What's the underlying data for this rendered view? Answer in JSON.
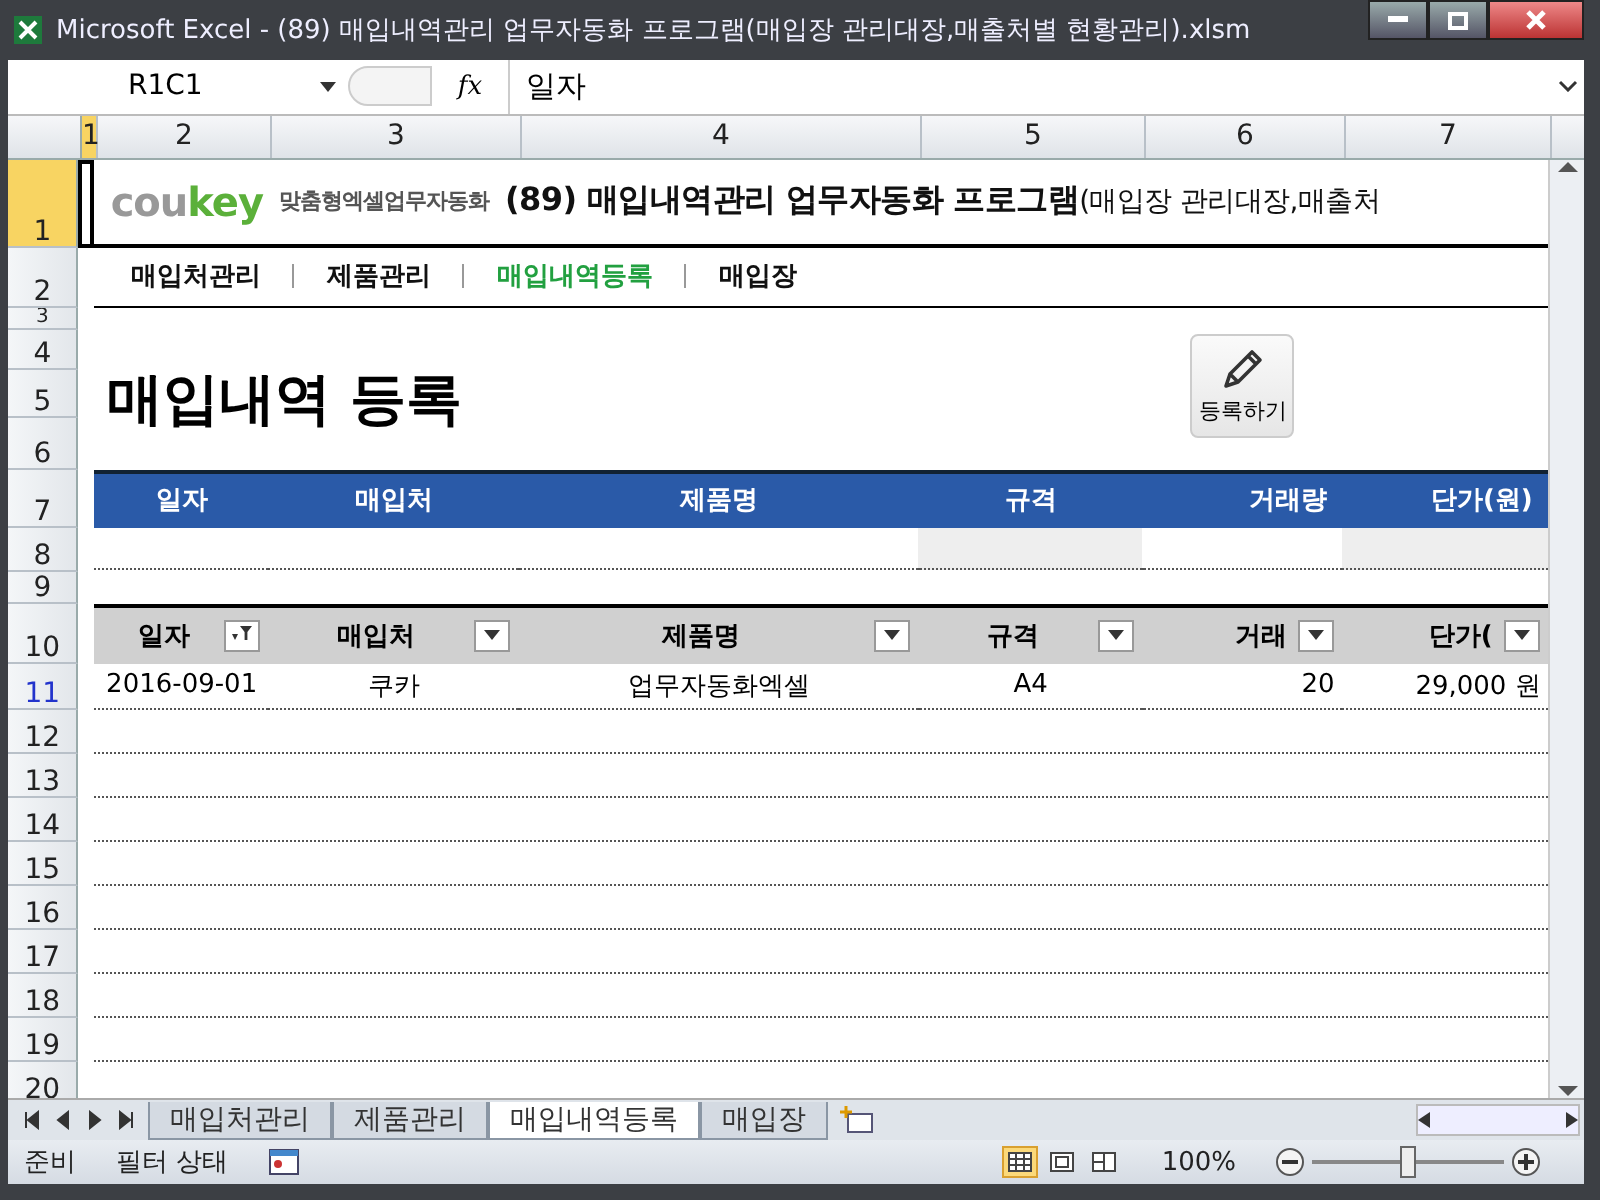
{
  "window": {
    "title": "Microsoft Excel - (89) 매입내역관리 업무자동화 프로그램(매입장 관리대장,매출처별 현황관리).xlsm"
  },
  "formula_bar": {
    "name_box": "R1C1",
    "fx": "fx",
    "formula": "일자"
  },
  "column_headers": [
    {
      "label": "1",
      "selected": true
    },
    {
      "label": "2",
      "selected": false
    },
    {
      "label": "3",
      "selected": false
    },
    {
      "label": "4",
      "selected": false
    },
    {
      "label": "5",
      "selected": false
    },
    {
      "label": "6",
      "selected": false
    },
    {
      "label": "7",
      "selected": false
    }
  ],
  "row_headers": [
    {
      "label": "1",
      "selected": true,
      "filtered": false
    },
    {
      "label": "2",
      "selected": false,
      "filtered": false
    },
    {
      "label": "3",
      "selected": false,
      "filtered": false
    },
    {
      "label": "4",
      "selected": false,
      "filtered": false
    },
    {
      "label": "5",
      "selected": false,
      "filtered": false
    },
    {
      "label": "6",
      "selected": false,
      "filtered": false
    },
    {
      "label": "7",
      "selected": false,
      "filtered": false
    },
    {
      "label": "8",
      "selected": false,
      "filtered": false
    },
    {
      "label": "9",
      "selected": false,
      "filtered": false
    },
    {
      "label": "10",
      "selected": false,
      "filtered": false
    },
    {
      "label": "11",
      "selected": false,
      "filtered": true
    },
    {
      "label": "12",
      "selected": false,
      "filtered": false
    },
    {
      "label": "13",
      "selected": false,
      "filtered": false
    },
    {
      "label": "14",
      "selected": false,
      "filtered": false
    },
    {
      "label": "15",
      "selected": false,
      "filtered": false
    },
    {
      "label": "16",
      "selected": false,
      "filtered": false
    },
    {
      "label": "17",
      "selected": false,
      "filtered": false
    },
    {
      "label": "18",
      "selected": false,
      "filtered": false
    },
    {
      "label": "19",
      "selected": false,
      "filtered": false
    },
    {
      "label": "20",
      "selected": false,
      "filtered": false
    }
  ],
  "banner": {
    "logo_a": "cou",
    "logo_b": "key",
    "tagline": "맞춤형엑셀업무자동화",
    "title": "**(89) 매입내역관리 업무자동화 프로그램**(매입장 관리대장,매출처"
  },
  "nav": [
    {
      "label": "매입처관리",
      "selected": false
    },
    {
      "label": "제품관리",
      "selected": false
    },
    {
      "label": "매입내역등록",
      "selected": true
    },
    {
      "label": "매입장",
      "selected": false
    }
  ],
  "heading": "매입내역 등록",
  "register_button": {
    "label": "등록하기"
  },
  "entry_table": {
    "columns": [
      "일자",
      "매입처",
      "제품명",
      "규격",
      "거래량",
      "단가(원)"
    ],
    "cells": [
      {
        "shaded": false
      },
      {
        "shaded": false
      },
      {
        "shaded": false
      },
      {
        "shaded": true
      },
      {
        "shaded": false
      },
      {
        "shaded": true
      }
    ]
  },
  "list_table": {
    "columns": [
      {
        "label": "일자",
        "filtered": true
      },
      {
        "label": "매입처",
        "filtered": false
      },
      {
        "label": "제품명",
        "filtered": false
      },
      {
        "label": "규격",
        "filtered": false
      },
      {
        "label": "거래",
        "filtered": false
      },
      {
        "label": "단가(",
        "filtered": false
      }
    ],
    "rows": [
      [
        "2016-09-01",
        "쿠카",
        "업무자동화엑셀",
        "A4",
        "20",
        "29,000 원"
      ]
    ]
  },
  "sheet_tabs": [
    {
      "label": "매입처관리",
      "selected": false
    },
    {
      "label": "제품관리",
      "selected": false
    },
    {
      "label": "매입내역등록",
      "selected": true
    },
    {
      "label": "매입장",
      "selected": false
    }
  ],
  "status_bar": {
    "items": [
      "준비",
      "필터 상태"
    ],
    "views": [
      {
        "selected": true
      },
      {
        "selected": false
      },
      {
        "selected": false
      }
    ],
    "zoom": "100%",
    "zoom_level": {
      "level": 0.5
    }
  }
}
